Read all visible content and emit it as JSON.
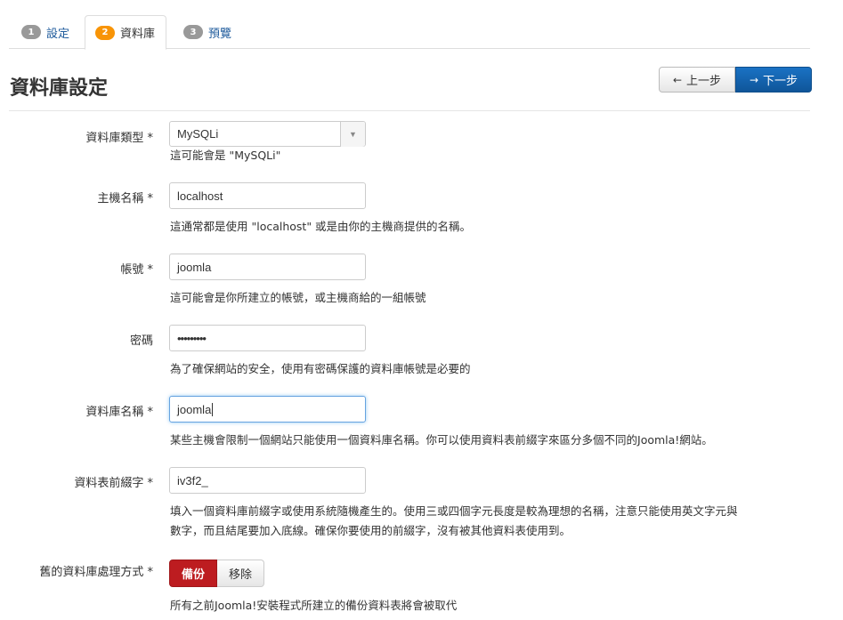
{
  "tabs": [
    {
      "num": "1",
      "label": "設定"
    },
    {
      "num": "2",
      "label": "資料庫"
    },
    {
      "num": "3",
      "label": "預覽"
    }
  ],
  "page_title": "資料庫設定",
  "nav": {
    "prev_label": "上一步",
    "next_label": "下一步",
    "prev_icon": "←",
    "next_icon": "→"
  },
  "fields": {
    "db_type": {
      "label": "資料庫類型 *",
      "value": "MySQLi",
      "help": "這可能會是 \"MySQLi\""
    },
    "host": {
      "label": "主機名稱 *",
      "value": "localhost",
      "help": "這通常都是使用 \"localhost\" 或是由你的主機商提供的名稱。"
    },
    "user": {
      "label": "帳號 *",
      "value": "joomla",
      "help": "這可能會是你所建立的帳號，或主機商給的一組帳號"
    },
    "password": {
      "label": "密碼",
      "value": "•••••••••",
      "help": "為了確保網站的安全，使用有密碼保護的資料庫帳號是必要的"
    },
    "db_name": {
      "label": "資料庫名稱 *",
      "value": "joomla",
      "help": "某些主機會限制一個網站只能使用一個資料庫名稱。你可以使用資料表前綴字來區分多個不同的Joomla!網站。"
    },
    "prefix": {
      "label": "資料表前綴字 *",
      "value": "iv3f2_",
      "help_line1": "填入一個資料庫前綴字或使用系統隨機產生的。使用三或四個字元長度是較為理想的名稱，注意只能使用英文字元與",
      "help_line2": "數字，而且結尾要加入底線。確保你要使用的前綴字，沒有被其他資料表使用到。"
    },
    "old_db": {
      "label": "舊的資料庫處理方式 *",
      "option_on": "備份",
      "option_off": "移除",
      "help": "所有之前Joomla!安裝程式所建立的備份資料表將會被取代"
    }
  },
  "colors": {
    "accent": "#1f5b9c",
    "active_step": "#f89406",
    "next_button": "#1a72c4",
    "backup_selected": "#bd1c20"
  }
}
